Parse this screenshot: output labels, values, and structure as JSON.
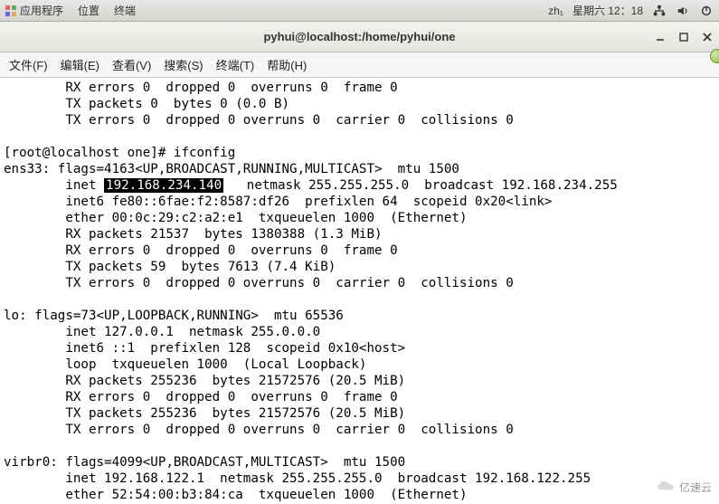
{
  "top_panel": {
    "apps": "应用程序",
    "places": "位置",
    "terminal": "终端",
    "locale": "zh₁",
    "clock": "星期六 12：18"
  },
  "window": {
    "title": "pyhui@localhost:/home/pyhui/one"
  },
  "menubar": {
    "file": "文件(F)",
    "edit": "编辑(E)",
    "view": "查看(V)",
    "search": "搜索(S)",
    "terminal": "终端(T)",
    "help": "帮助(H)"
  },
  "terminal_output": {
    "prev_rx_err": "        RX errors 0  dropped 0  overruns 0  frame 0",
    "prev_tx_pkts": "        TX packets 0  bytes 0 (0.0 B)",
    "prev_tx_err": "        TX errors 0  dropped 0 overruns 0  carrier 0  collisions 0",
    "blank1": "",
    "prompt": "[root@localhost one]# ifconfig",
    "ens33_flags": "ens33: flags=4163<UP,BROADCAST,RUNNING,MULTICAST>  mtu 1500",
    "ens33_inet_pre": "        inet ",
    "ens33_inet_ip": "192.168.234.140",
    "ens33_inet_post": "   netmask 255.255.255.0  broadcast 192.168.234.255",
    "ens33_inet6": "        inet6 fe80::6fae:f2:8587:df26  prefixlen 64  scopeid 0x20<link>",
    "ens33_ether": "        ether 00:0c:29:c2:a2:e1  txqueuelen 1000  (Ethernet)",
    "ens33_rx_pkts": "        RX packets 21537  bytes 1380388 (1.3 MiB)",
    "ens33_rx_err": "        RX errors 0  dropped 0  overruns 0  frame 0",
    "ens33_tx_pkts": "        TX packets 59  bytes 7613 (7.4 KiB)",
    "ens33_tx_err": "        TX errors 0  dropped 0 overruns 0  carrier 0  collisions 0",
    "blank2": "",
    "lo_flags": "lo: flags=73<UP,LOOPBACK,RUNNING>  mtu 65536",
    "lo_inet": "        inet 127.0.0.1  netmask 255.0.0.0",
    "lo_inet6": "        inet6 ::1  prefixlen 128  scopeid 0x10<host>",
    "lo_loop": "        loop  txqueuelen 1000  (Local Loopback)",
    "lo_rx_pkts": "        RX packets 255236  bytes 21572576 (20.5 MiB)",
    "lo_rx_err": "        RX errors 0  dropped 0  overruns 0  frame 0",
    "lo_tx_pkts": "        TX packets 255236  bytes 21572576 (20.5 MiB)",
    "lo_tx_err": "        TX errors 0  dropped 0 overruns 0  carrier 0  collisions 0",
    "blank3": "",
    "virbr0_flags": "virbr0: flags=4099<UP,BROADCAST,MULTICAST>  mtu 1500",
    "virbr0_inet": "        inet 192.168.122.1  netmask 255.255.255.0  broadcast 192.168.122.255",
    "virbr0_ether": "        ether 52:54:00:b3:84:ca  txqueuelen 1000  (Ethernet)"
  },
  "watermark": {
    "text": "亿速云"
  }
}
